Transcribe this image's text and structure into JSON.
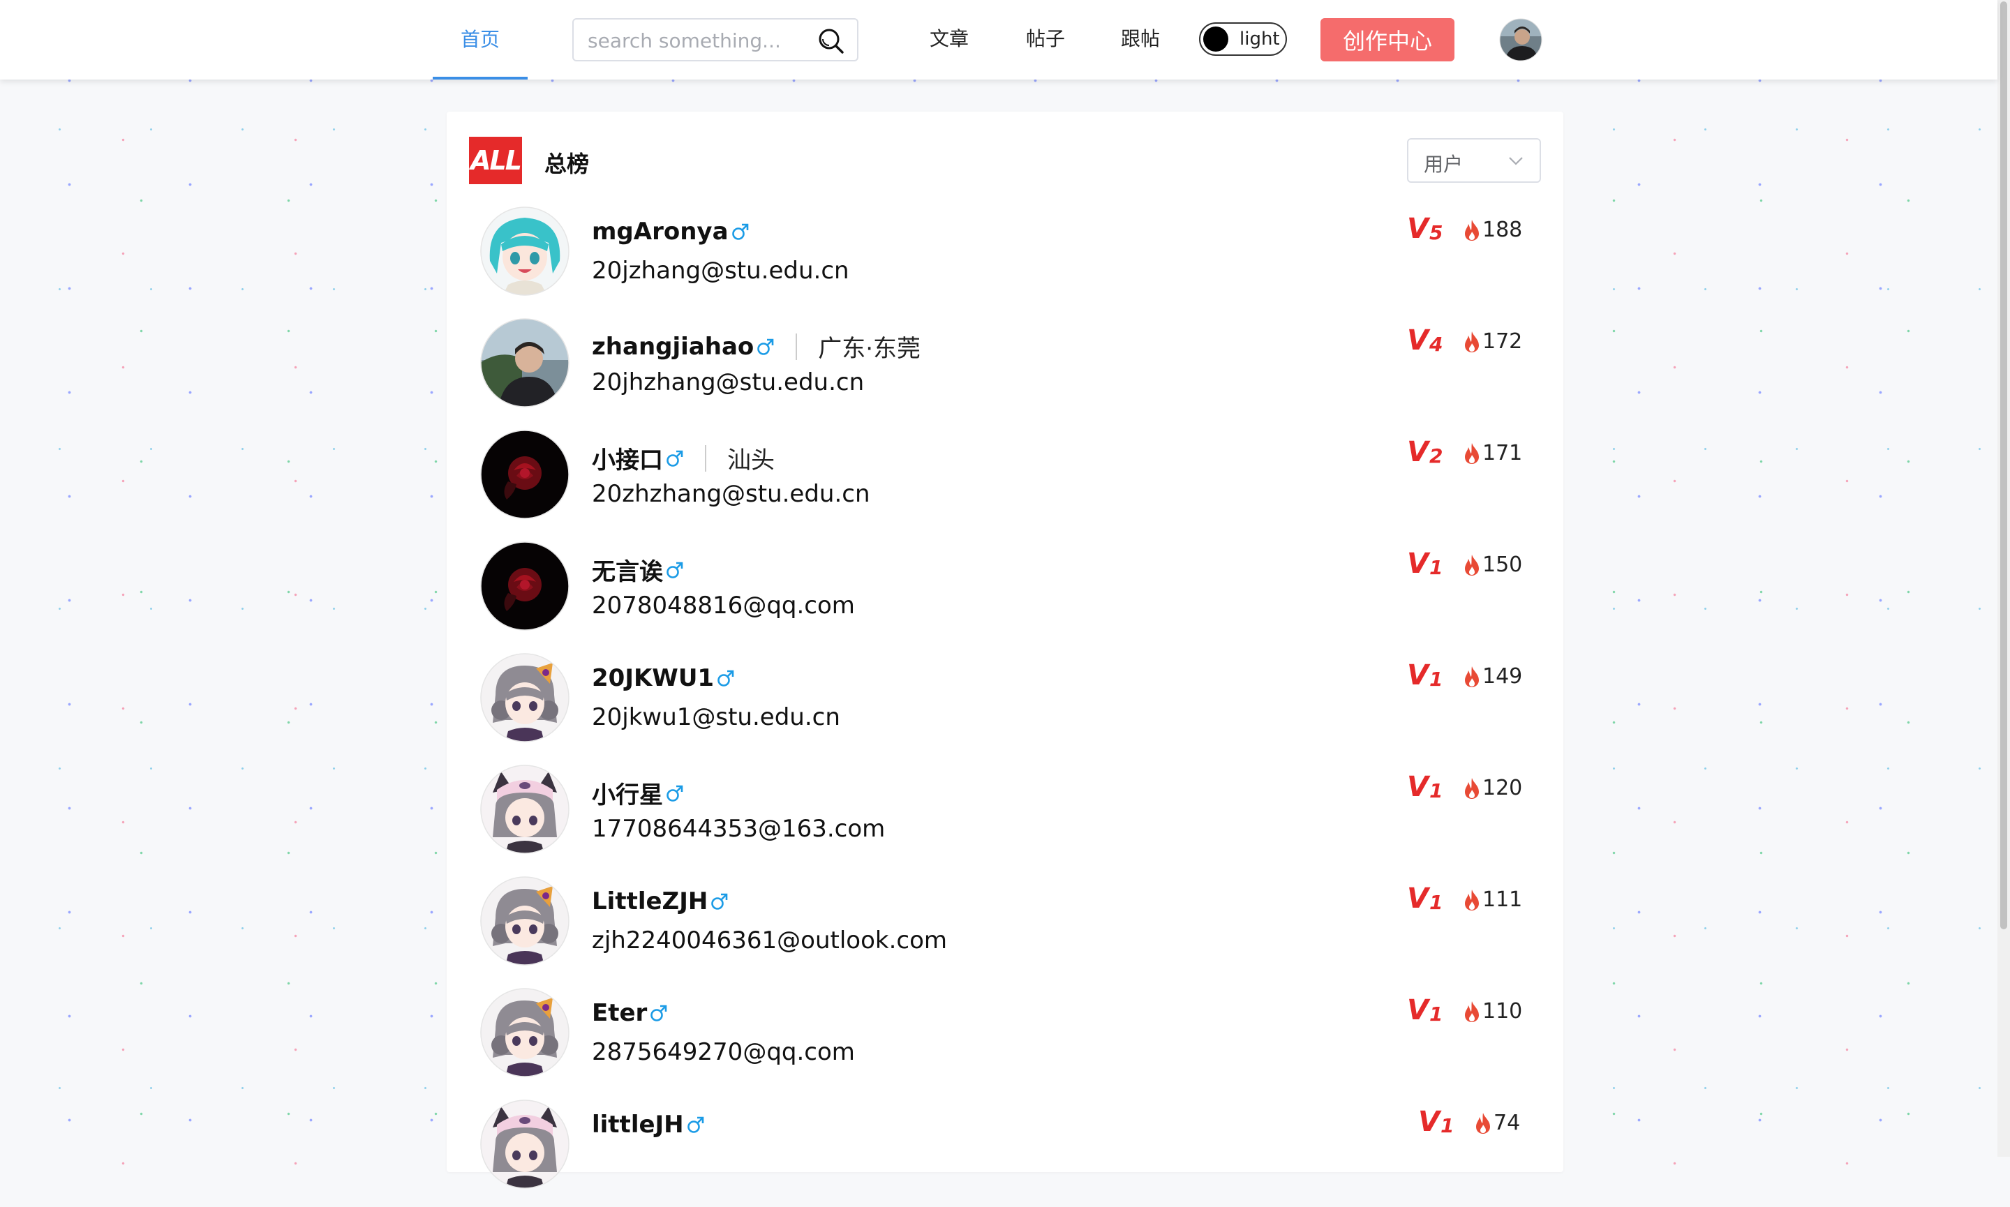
{
  "header": {
    "home_label": "首页",
    "search_placeholder": "search something...",
    "nav": [
      "文章",
      "帖子",
      "跟帖"
    ],
    "theme_label": "light",
    "create_label": "创作中心"
  },
  "leaderboard": {
    "logo_text": "ALL",
    "title": "总榜",
    "type_selected": "用户",
    "users": [
      {
        "name": "mgAronya",
        "location": "",
        "email": "20jzhang@stu.edu.cn",
        "vip_level": "5",
        "heat": "188",
        "avatar": "anime-teal"
      },
      {
        "name": "zhangjiahao",
        "location": "广东·东莞",
        "email": "20jhzhang@stu.edu.cn",
        "vip_level": "4",
        "heat": "172",
        "avatar": "photo"
      },
      {
        "name": "小接口",
        "location": "汕头",
        "email": "20zhzhang@stu.edu.cn",
        "vip_level": "2",
        "heat": "171",
        "avatar": "rose"
      },
      {
        "name": "无言诶",
        "location": "",
        "email": "2078048816@qq.com",
        "vip_level": "1",
        "heat": "150",
        "avatar": "rose"
      },
      {
        "name": "20JKWU1",
        "location": "",
        "email": "20jkwu1@stu.edu.cn",
        "vip_level": "1",
        "heat": "149",
        "avatar": "anime-gray-hat"
      },
      {
        "name": "小行星",
        "location": "",
        "email": "17708644353@163.com",
        "vip_level": "1",
        "heat": "120",
        "avatar": "anime-gray-pink"
      },
      {
        "name": "LittleZJH",
        "location": "",
        "email": "zjh2240046361@outlook.com",
        "vip_level": "1",
        "heat": "111",
        "avatar": "anime-gray-hat"
      },
      {
        "name": "Eter",
        "location": "",
        "email": "2875649270@qq.com",
        "vip_level": "1",
        "heat": "110",
        "avatar": "anime-gray-hat"
      },
      {
        "name": "littleJH",
        "location": "",
        "email": "",
        "vip_level": "1",
        "heat": "74",
        "avatar": "anime-gray-pink"
      }
    ]
  },
  "colors": {
    "accent": "#3a8ee6",
    "brand_red": "#e52a2a",
    "create_button": "#f56c6c",
    "male_icon": "#1a9be6"
  }
}
